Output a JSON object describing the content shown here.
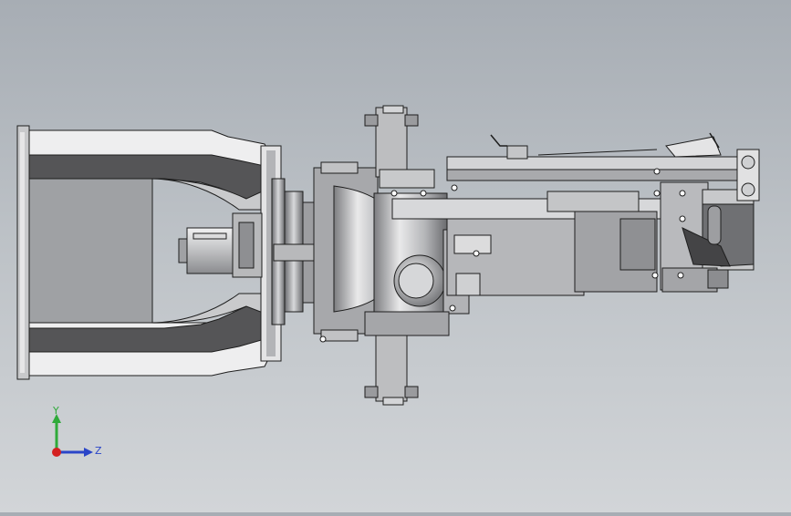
{
  "viewport": {
    "background_top": "#a7adb4",
    "background_bottom": "#d2d5d8",
    "model_colors": {
      "light": "#efeff0",
      "mid": "#c6c7c9",
      "dark": "#555555",
      "shade": "#8c8d90",
      "edge": "#1e1e1e"
    }
  },
  "triad": {
    "y_label": "Y",
    "z_label": "Z",
    "y_color": "#2faa3a",
    "z_color": "#2a45c8",
    "x_color": "#d42020"
  }
}
